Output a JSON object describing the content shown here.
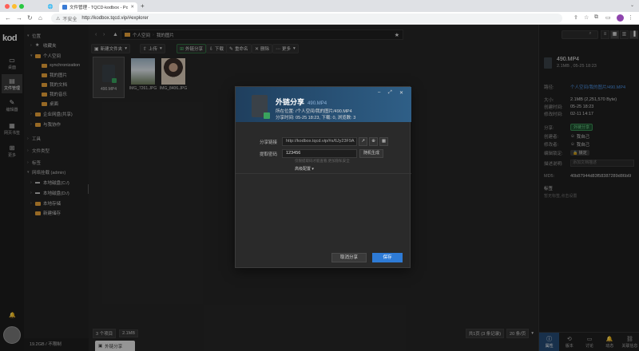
{
  "browser": {
    "tab_title": "文件管理 - TQCD-kodbox - Po",
    "url": "http://kodbox.tqcd.vip/#explorer",
    "security_label": "不安全"
  },
  "rail": {
    "items": [
      {
        "label": "桌面",
        "icon": "desktop-icon"
      },
      {
        "label": "文件管理",
        "icon": "folder-icon"
      },
      {
        "label": "编辑器",
        "icon": "editor-icon"
      },
      {
        "label": "网页书签",
        "icon": "bookmark-icon"
      },
      {
        "label": "更多",
        "icon": "grid-icon"
      }
    ]
  },
  "tree": {
    "location": "位置",
    "favorites": "收藏夹",
    "personal": "个人空间",
    "folders": [
      "synchronization",
      "我的图片",
      "我的文档",
      "我的音乐",
      "桌面"
    ],
    "enterprise": "企业网盘(共享)",
    "cooperation": "与我协作",
    "tools": "工具",
    "file_types": "文件类型",
    "tags": "标签",
    "network": "网络挂载 (admin)",
    "disks": [
      "本地磁盘(C:/)",
      "本地磁盘(D:/)",
      "本地存储",
      "新建储存"
    ],
    "storage": "19.2GB / 不限制"
  },
  "main": {
    "breadcrumb": [
      "个人空间",
      "我的图片"
    ],
    "toolbar": {
      "new_folder": "新建文件夹",
      "upload": "上传",
      "share_link": "外链分享",
      "download": "下载",
      "rename": "重命名",
      "delete": "删除",
      "more": "更多"
    },
    "files": [
      {
        "name": "490.MP4"
      },
      {
        "name": "IMG_7261.JPG"
      },
      {
        "name": "IMG_8406.JPG"
      }
    ],
    "status": {
      "count": "3 个项目",
      "size": "2.1MB",
      "pages": "共1页 (3 条记录)",
      "per_page": "20 条/页"
    }
  },
  "panel": {
    "file_name": "490.MP4",
    "file_meta": "2.1MB , 05-25 18:23",
    "rows": {
      "path_k": "路径:",
      "path_v": "个人空间/我的图片/490.MP4",
      "size_k": "大小:",
      "size_v": "2.1MB (2,251,570 Byte)",
      "created_k": "创建时间:",
      "created_v": "05-25 18:23",
      "modified_k": "修改时间:",
      "modified_v": "02-11 14:17",
      "share_k": "分享:",
      "share_v": "外链分享",
      "creator_k": "创建者:",
      "creator_v": "我自己",
      "modifier_k": "修改者:",
      "modifier_v": "我自己",
      "lock_k": "编辑锁定:",
      "lock_v": "锁定",
      "desc_k": "描述说明:",
      "desc_v": "添加文档描述",
      "md5_k": "MD5:",
      "md5_v": "40b87944d83f58387289d86b6f"
    },
    "tags_title": "标签",
    "tags_empty": "暂无标签,点击设置",
    "nav": [
      "属性",
      "版本",
      "讨论",
      "动态",
      "关联信息"
    ]
  },
  "modal": {
    "title": "外链分享",
    "file_name": "490.MP4",
    "location": "所在位置: /个人空间/我的图片/490.MP4",
    "time": "分享时间: 05-25 18:23, 下载: 0, 浏览数: 3",
    "link_label": "分享链接",
    "link_value": "http://kodbox.tqcd.vip/#s/6Jy23F9A",
    "code_label": "提取密码",
    "code_value": "123456",
    "random_btn": "随机生成",
    "hint": "仅限提取码才能查看,更加隐私安全",
    "advanced": "高级配置",
    "cancel": "取消分享",
    "save": "保存"
  }
}
